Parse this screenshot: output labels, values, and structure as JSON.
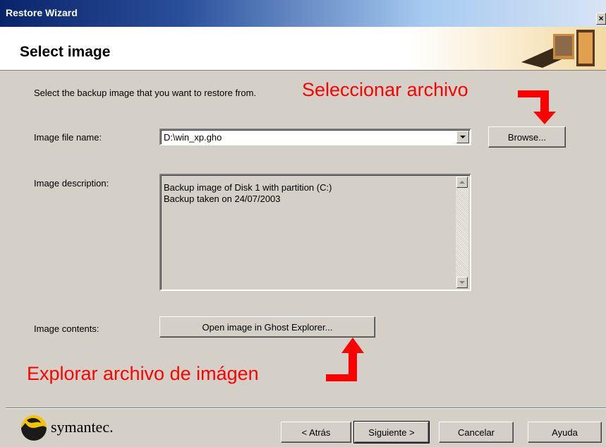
{
  "window": {
    "title": "Restore Wizard"
  },
  "header": {
    "title": "Select image"
  },
  "intro": "Select the backup image that you want to restore from.",
  "annotations": {
    "select_file": "Seleccionar archivo",
    "explore_file": "Explorar archivo de imágen"
  },
  "file": {
    "label": "Image file name:",
    "value": "D:\\win_xp.gho",
    "browse_label": "Browse..."
  },
  "description": {
    "label": "Image description:",
    "lines": [
      "Backup image of Disk 1 with partition (C:)",
      "Backup taken on 24/07/2003"
    ]
  },
  "contents": {
    "label": "Image contents:",
    "button_label": "Open image in Ghost Explorer..."
  },
  "footer": {
    "brand": "symantec.",
    "back_label": "< Atrás",
    "next_label": "Siguiente >",
    "cancel_label": "Cancelar",
    "help_label": "Ayuda"
  },
  "colors": {
    "annotation": "#ff0000",
    "titlebar": "#0a246a",
    "dialog": "#d4d0c8"
  }
}
